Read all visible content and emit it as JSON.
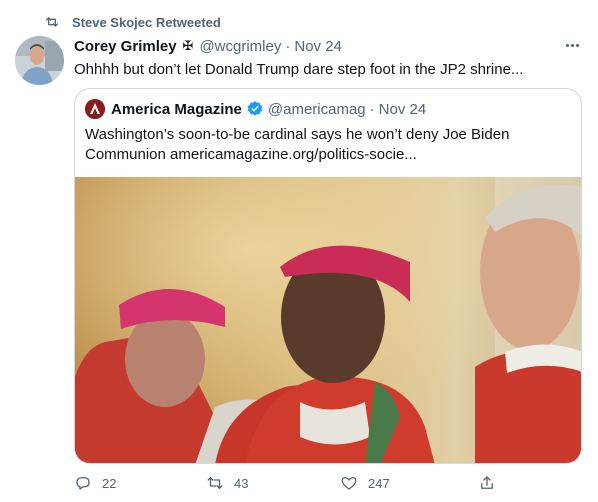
{
  "retweet_banner": {
    "text": "Steve Skojec Retweeted"
  },
  "tweet": {
    "author_name": "Corey Grimley",
    "author_badge": "✠",
    "handle": "@wcgrimley",
    "separator": "·",
    "date": "Nov 24",
    "text": "Ohhhh but don’t let Donald Trump dare step foot in the JP2 shrine..."
  },
  "quote": {
    "author_name": "America Magazine",
    "handle": "@americamag",
    "separator": "·",
    "date": "Nov 24",
    "text": "Washington’s soon-to-be cardinal says he won’t deny Joe Biden Communion americamagazine.org/politics-socie..."
  },
  "actions": {
    "replies": "22",
    "retweets": "43",
    "likes": "247"
  },
  "colors": {
    "accent": "#1d9bf0",
    "muted": "#536471",
    "border": "#cfd9de",
    "brand_logo": "#8a1c1c"
  }
}
